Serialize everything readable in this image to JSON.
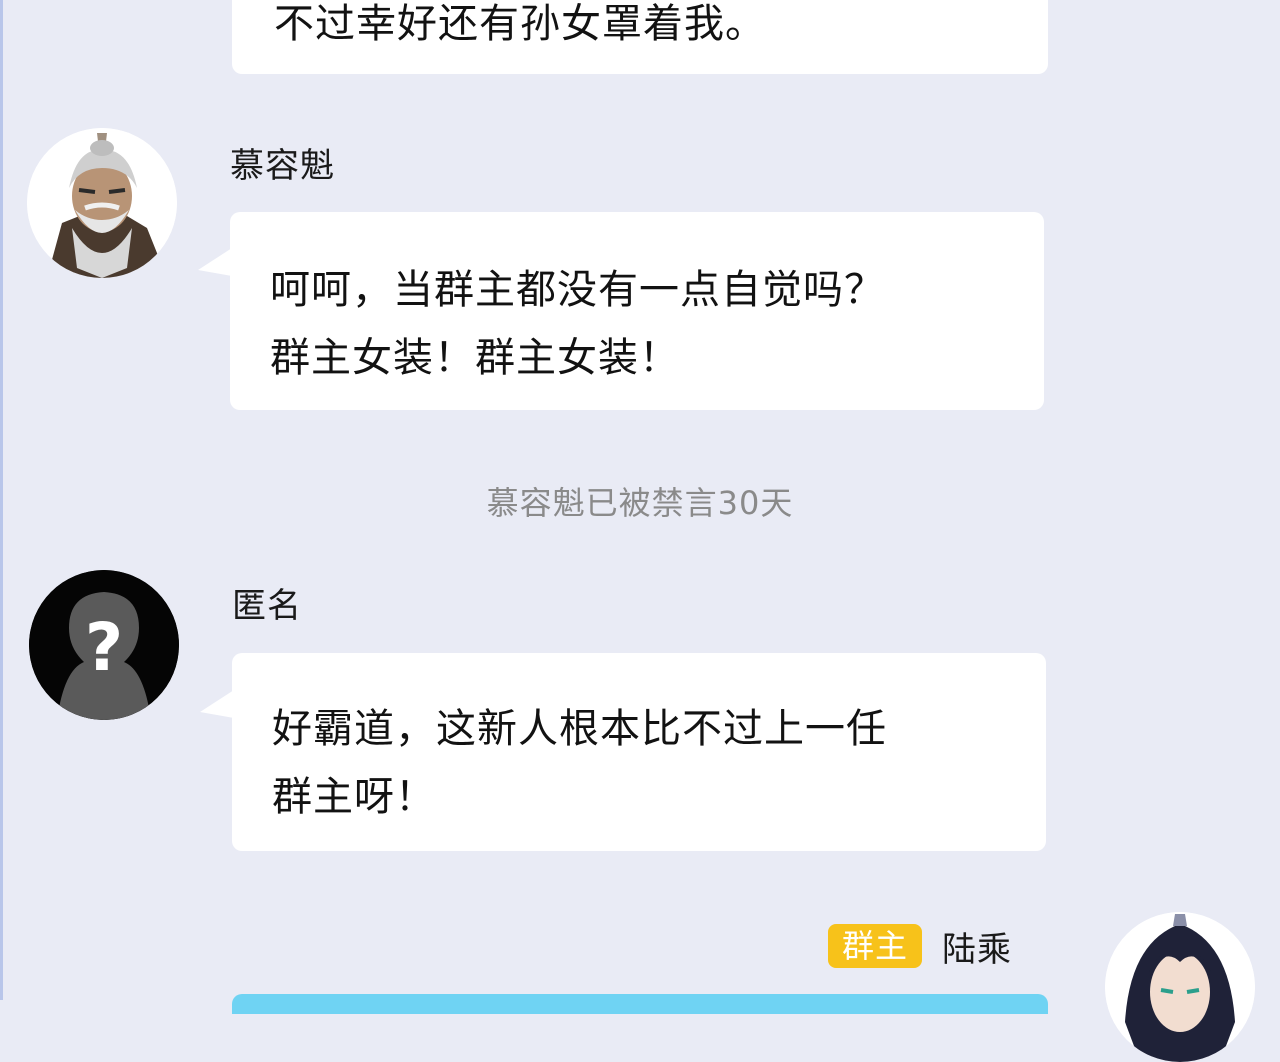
{
  "messages": [
    {
      "text": "不过幸好还有孙女罩着我。"
    },
    {
      "sender": "慕容魁",
      "avatar_icon": "old-man-avatar",
      "text": "呵呵，当群主都没有一点自觉吗？\n群主女装！群主女装！"
    },
    {
      "sender": "匿名",
      "avatar_icon": "anonymous-question-avatar",
      "text": "好霸道，这新人根本比不过上一任\n群主呀！"
    },
    {
      "sender": "陆乘",
      "badge": "群主",
      "avatar_icon": "young-man-avatar"
    }
  ],
  "system_message": "慕容魁已被禁言30天",
  "colors": {
    "background": "#e9ebf5",
    "bubble": "#ffffff",
    "badge": "#f7c21a",
    "system_text": "#8a8a8a",
    "own_bubble": "#6fd3f3"
  }
}
